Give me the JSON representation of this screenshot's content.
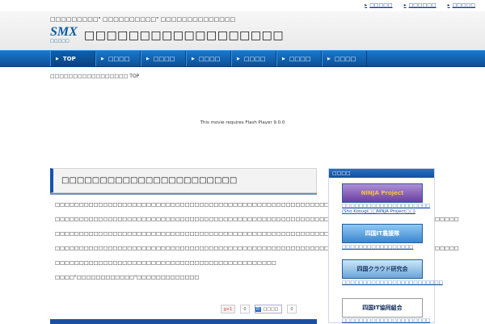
{
  "top_links": [
    "□□□□□",
    "□□□□□□",
    "□□□□□"
  ],
  "header": {
    "tagline": "□□□□□□□□□\" □□□□□□□□□□\" □□□□□□□□□□□□□□",
    "logo_text": "SMX",
    "logo_sub": "□□□□□",
    "site_title": "□□□□□□□□□□□□□□□□□□"
  },
  "nav": [
    {
      "label": "TOP"
    },
    {
      "label": "□□□□"
    },
    {
      "label": "□□□□"
    },
    {
      "label": "□□□□"
    },
    {
      "label": "□□□□"
    },
    {
      "label": "□□□□"
    },
    {
      "label": "□□□□"
    }
  ],
  "breadcrumb": "□□□□□□□□□□□□□□□□□ TOP",
  "flash_message": "This movie requires Flash Player 9.0.0",
  "main": {
    "title": "□□□□□□□□□□□□□□□□□□□□□□□",
    "paragraphs": [
      "□□□□□□□□□□□□□□□□□□□□□□□□□□□□□□□□□□□□□□□□□□□□□□□□□□□□□□□□□□□□□□□□□□□□□□□□□□",
      "□□□□□□□□□□□□□□□□□□□□□□□□□□□□□□□□□□□□□□□□□□□□□□□□□□□□□□□□□□□□□□□□□□□□□□□□□□□□□□□□□□□□",
      "□□□□□□□□□□□□□□□□□□□□□□□□□□□□□□□□□□□□□□□□□□□□□□□□□□□□□□□□□□□□□□□",
      "□□□□□□□□□□□□□□□□□□□□□□□□□□□□□□□□□□□□□□□□□□□□□□□□□□□□□□□□□□□□□□□□□□□□□□□□□□□□□□□□□□□□",
      "□□□□□□□□□□□□□□□□□□□□□□□□□□□□□□□□□□□□□□□□□□□□□□",
      "□□□□\"□□□□□□□□□□□□\"□□□□□□□□□□□□□"
    ],
    "gplus_label": "g+1",
    "gplus_count": "0",
    "hatena_label": "□□□□",
    "hatena_count": "0"
  },
  "sidebar": {
    "heading": "□□□□",
    "banners": [
      {
        "image_text": "NINJA Project",
        "caption": "□□□□□□□□□□□□□□□□□□□□□ (Sho Kosugi□□NINJA Project□□)"
      },
      {
        "image_text": "四国IT農援隊",
        "caption": "□□□□□□□□□□□□□□□□□"
      },
      {
        "image_text": "四国クラウド研究会",
        "caption": "□□□□□□□□□□□□□□□□□□□□□□□□"
      },
      {
        "image_text": "四国IT協同組合",
        "caption": "□□□□□□□□□□□□□□□□□□□□□"
      }
    ]
  }
}
